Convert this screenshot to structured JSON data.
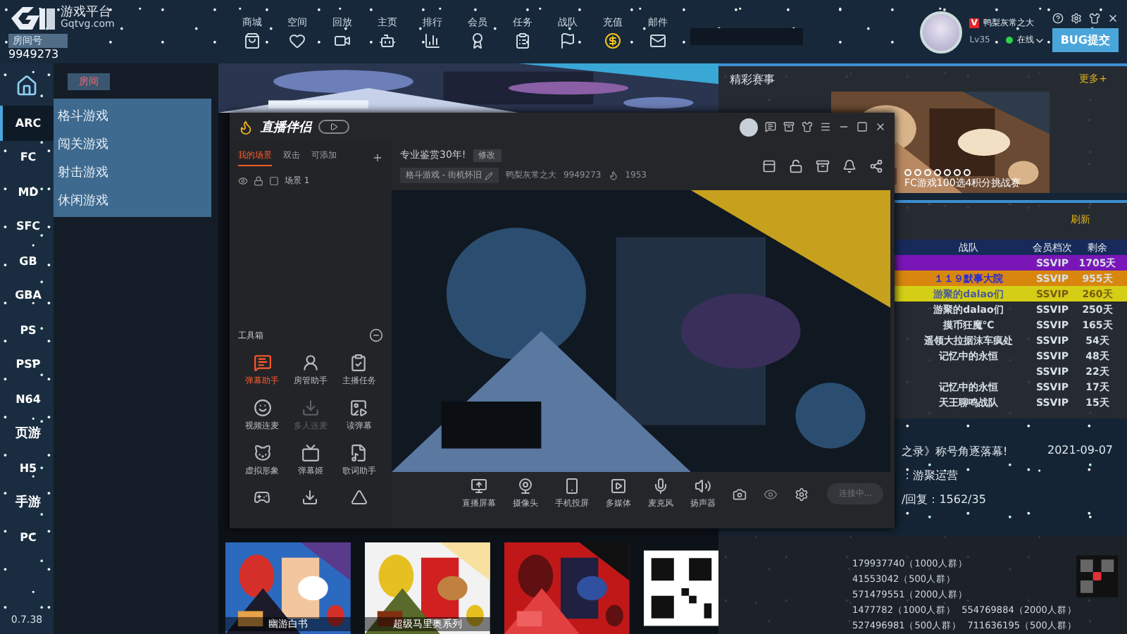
{
  "header": {
    "logo_text": "游戏平台",
    "logo_domain": "Gqtvg.com",
    "room_label": "房间号",
    "room_number": "9949273",
    "nav": [
      {
        "label": "商城"
      },
      {
        "label": "空间"
      },
      {
        "label": "回放"
      },
      {
        "label": "主页"
      },
      {
        "label": "排行"
      },
      {
        "label": "会员"
      },
      {
        "label": "任务"
      },
      {
        "label": "战队"
      },
      {
        "label": "充值"
      },
      {
        "label": "邮件"
      }
    ],
    "user": {
      "vip_badge": "V",
      "name": "鸭梨灰常之大",
      "level": "Lv35",
      "status": "在线"
    },
    "bug_button": "BUG提交"
  },
  "sidebar": {
    "items": [
      {
        "label": "ARC",
        "selected": true
      },
      {
        "label": "FC",
        "selected": false
      },
      {
        "label": "MD",
        "selected": false
      },
      {
        "label": "SFC",
        "selected": false
      },
      {
        "label": "GB",
        "selected": false
      },
      {
        "label": "GBA",
        "selected": false
      },
      {
        "label": "PS",
        "selected": false
      },
      {
        "label": "PSP",
        "selected": false
      },
      {
        "label": "N64",
        "selected": false
      },
      {
        "label": "页游",
        "selected": false
      },
      {
        "label": "H5",
        "selected": false
      },
      {
        "label": "手游",
        "selected": false
      },
      {
        "label": "PC",
        "selected": false
      }
    ],
    "version": "0.7.38"
  },
  "submenu": {
    "tab": "房间",
    "items": [
      {
        "label": "格斗游戏"
      },
      {
        "label": "闯关游戏"
      },
      {
        "label": "射击游戏"
      },
      {
        "label": "休闲游戏"
      }
    ]
  },
  "games": [
    {
      "title": "幽游白书"
    },
    {
      "title": "超级马里奥系列"
    }
  ],
  "events": {
    "title": "精彩赛事",
    "more": "更多+",
    "caption": "FC游戏100选4积分挑战赛"
  },
  "ranking": {
    "refresh": "刷新",
    "columns": [
      "战队",
      "会员档次",
      "剩余"
    ],
    "rows": [
      {
        "tier": "SSVIP",
        "days": "1705天",
        "color": "#7a16b8"
      },
      {
        "team": "１１９默事大院",
        "tier": "SSVIP",
        "days": "955天",
        "color": "#d8860e"
      },
      {
        "team": "游聚的dalao们",
        "tier": "SSVIP",
        "days": "260天",
        "color": "#d4cf16"
      },
      {
        "team": "游聚的dalao们",
        "tier": "SSVIP",
        "days": "250天"
      },
      {
        "team": "摸币狂魔℃",
        "tier": "SSVIP",
        "days": "165天"
      },
      {
        "team": "遥领大拉据沫车疯处",
        "tier": "SSVIP",
        "days": "54天"
      },
      {
        "team": "记忆中的永恒",
        "tier": "SSVIP",
        "days": "48天"
      },
      {
        "tier": "SSVIP",
        "days": "22天"
      },
      {
        "team": "记忆中的永恒",
        "tier": "SSVIP",
        "days": "17天"
      },
      {
        "team": "天王聊鸣战队",
        "tier": "SSVIP",
        "days": "15天"
      }
    ]
  },
  "notice": {
    "title": "之录》称号角逐落幕!",
    "date": "2021-09-07",
    "author": "：游聚运营",
    "stats": "/回复：1562/35"
  },
  "qq_groups": [
    "179937740（1000人群）",
    "41553042（500人群）",
    "571479551（2000人群）",
    "1477782（1000人群）  554769884（2000人群）",
    "527496981（500人群）  711636195（500人群）"
  ],
  "live_app": {
    "title": "直播伴侣",
    "scene_tabs": [
      {
        "label": "我的场景",
        "selected": true
      },
      {
        "label": "双击",
        "selected": false
      },
      {
        "label": "可添加",
        "selected": false
      }
    ],
    "scene": "场景 1",
    "toolbox_title": "工具箱",
    "tools": [
      {
        "label": "弹幕助手",
        "selected": true,
        "disabled": false
      },
      {
        "label": "房管助手",
        "selected": false,
        "disabled": false
      },
      {
        "label": "主播任务",
        "selected": false,
        "disabled": false
      },
      {
        "label": "视频连麦",
        "selected": false,
        "disabled": false
      },
      {
        "label": "多人连麦",
        "selected": false,
        "disabled": true
      },
      {
        "label": "读弹幕",
        "selected": false,
        "disabled": false
      },
      {
        "label": "虚拟形象",
        "selected": false,
        "disabled": false
      },
      {
        "label": "弹幕姬",
        "selected": false,
        "disabled": false
      },
      {
        "label": "歌词助手",
        "selected": false,
        "disabled": false
      }
    ],
    "stream_title": "专业鉴赏30年!",
    "edit_tag": "修改",
    "category": "格斗游戏 - 街机怀旧",
    "streamer": "鸭梨灰常之大",
    "room": "9949273",
    "heat": "1953",
    "sources": [
      {
        "label": "直播屏幕"
      },
      {
        "label": "摄像头"
      },
      {
        "label": "手机投屏"
      },
      {
        "label": "多媒体"
      },
      {
        "label": "麦克风"
      },
      {
        "label": "扬声器"
      }
    ],
    "connect_button": "连接中..."
  }
}
